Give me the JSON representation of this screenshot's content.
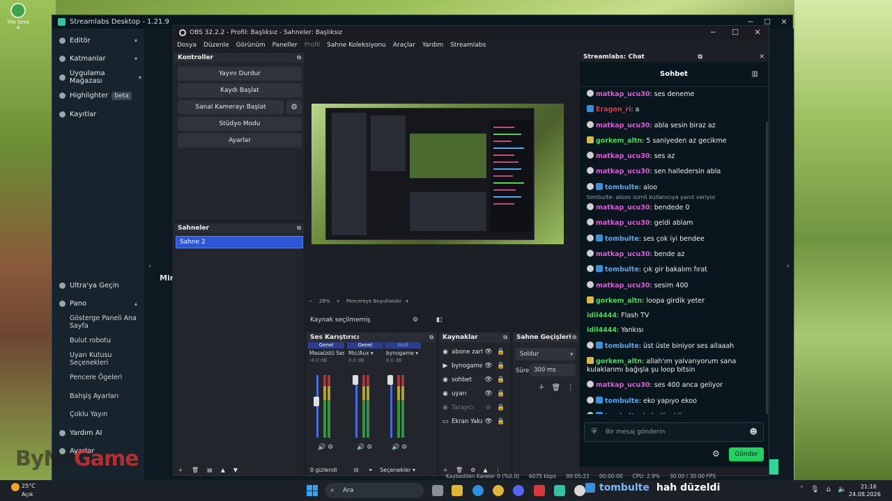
{
  "desktop": {
    "icon_label": "The Sims 4"
  },
  "streamlabs": {
    "title": "Streamlabs Desktop - 1.21.9",
    "nav_top": [
      {
        "label": "Editör"
      },
      {
        "label": "Katmanlar"
      },
      {
        "label": "Uygulama Mağazası"
      },
      {
        "label": "Highlighter",
        "badge": "beta"
      },
      {
        "label": "Kayıtlar"
      }
    ],
    "nav_bottom": {
      "ultra": "Ultra'ya Geçin",
      "pano": "Pano",
      "pano_items": [
        "Gösterge Paneli Ana Sayfa",
        "Bulut robotu",
        "Uyarı Kutusu Seçenekleri",
        "Pencere Ögeleri",
        "Bahşiş Ayarları",
        "Çoklu Yayın"
      ],
      "yardim": "Yardım AI",
      "ayarlar": "Ayarlar"
    },
    "mini_label": "Min"
  },
  "obs": {
    "title": "OBS 32.2.2 - Profil: Başlıksız - Sahneler: Başlıksız",
    "menu": [
      "Dosya",
      "Düzenle",
      "Görünüm",
      "Paneller",
      "Profil",
      "Sahne Koleksiyonu",
      "Araçlar",
      "Yardım",
      "Streamlabs"
    ],
    "controls": {
      "title": "Kontroller",
      "buttons": [
        "Yayını Durdur",
        "Kaydı Başlat",
        "Sanal Kamerayı Başlat",
        "Stüdyo Modu",
        "Ayarlar"
      ]
    },
    "scenes": {
      "title": "Sahneler",
      "items": [
        "Sahne 2"
      ]
    },
    "preview_zoom": "28%",
    "preview_fit": "Pencereye Boyutlandır",
    "no_source": "Kaynak seçilmemiş",
    "mixer": {
      "title": "Ses Karıştırıcı",
      "channels": [
        {
          "tag": "Genel",
          "name": "Masaüstü Ses",
          "db": "-4.0 dB",
          "level": 0.35
        },
        {
          "tag": "Genel",
          "name": "Mic/Aux",
          "db": "0.0 dB",
          "level": 0.0
        },
        {
          "tag": "Aktif",
          "name": "bynogame",
          "db": "0.0 dB",
          "level": 0.0
        }
      ],
      "hidden": "0 gizlendi",
      "options": "Seçenekler"
    },
    "sources": {
      "title": "Kaynaklar",
      "items": [
        {
          "icon": "globe-icon",
          "name": "abone zart",
          "dim": false
        },
        {
          "icon": "play-icon",
          "name": "bynogame",
          "dim": false
        },
        {
          "icon": "globe-icon",
          "name": "sohbet",
          "dim": false
        },
        {
          "icon": "globe-icon",
          "name": "uyarı",
          "dim": false
        },
        {
          "icon": "globe-icon",
          "name": "Tarayıcı",
          "dim": true
        },
        {
          "icon": "monitor-icon",
          "name": "Ekran Yaka",
          "dim": false
        }
      ]
    },
    "transitions": {
      "title": "Sahne Geçişleri",
      "type": "Soldur",
      "duration_label": "Süre",
      "duration": "300 ms"
    },
    "status": [
      "Kaybedilen Kareler 0 (%0.0)",
      "6075 kbps",
      "00:05:21",
      "00:00:00",
      "CPU: 2.9%",
      "30.00 / 30.00 FPS"
    ]
  },
  "chat": {
    "header": "Streamlabs: Chat",
    "title": "Sohbet",
    "messages": [
      {
        "user": "matkap_ucu30",
        "text": "ses deneme",
        "color": "#e05ad8",
        "badge": "circle"
      },
      {
        "user": "Eragon_ri",
        "text": "a",
        "color": "#e0384b",
        "badge": "square"
      },
      {
        "user": "matkap_ucu30",
        "text": "abla sesin biraz az",
        "color": "#e05ad8",
        "badge": "circle"
      },
      {
        "user": "gorkem_altn",
        "text": "5 saniyeden az gecikme",
        "color": "#4ed85a",
        "badge": "sub"
      },
      {
        "user": "matkap_ucu30",
        "text": "ses az",
        "color": "#e05ad8",
        "badge": "circle"
      },
      {
        "user": "matkap_ucu30",
        "text": "sen halledersin abla",
        "color": "#e05ad8",
        "badge": "circle"
      },
      {
        "user": "tombulte",
        "text": "aloo",
        "color": "#5aa8f0",
        "badge": "both"
      },
      {
        "user": "matkap_ucu30",
        "text": "bendede 0",
        "color": "#e05ad8",
        "badge": "circle",
        "reply": "tombulte: alooo isimli kullanıcıya yanıt veriyor"
      },
      {
        "user": "matkap_ucu30",
        "text": "geldi ablam",
        "color": "#e05ad8",
        "badge": "circle"
      },
      {
        "user": "tombulte",
        "text": "ses çok iyi bendee",
        "color": "#5aa8f0",
        "badge": "both"
      },
      {
        "user": "matkap_ucu30",
        "text": "bende az",
        "color": "#e05ad8",
        "badge": "circle"
      },
      {
        "user": "tombulte",
        "text": "çık gir bakalım fırat",
        "color": "#5aa8f0",
        "badge": "both"
      },
      {
        "user": "matkap_ucu30",
        "text": "sesim 400",
        "color": "#e05ad8",
        "badge": "circle"
      },
      {
        "user": "gorkem_altn",
        "text": "loopa girdik yeter",
        "color": "#4ed85a",
        "badge": "sub"
      },
      {
        "user": "idil4444",
        "text": "Flash TV",
        "color": "#4ed85a",
        "badge": "none"
      },
      {
        "user": "idil4444",
        "text": "Yankısı",
        "color": "#4ed85a",
        "badge": "none"
      },
      {
        "user": "tombulte",
        "text": "üst üste biniyor ses allaaah",
        "color": "#5aa8f0",
        "badge": "both"
      },
      {
        "user": "gorkem_altn",
        "text": "allah'ım yalvarıyorum sana kulaklarımı bağışla şu loop bitsin",
        "color": "#4ed85a",
        "badge": "sub"
      },
      {
        "user": "matkap_ucu30",
        "text": "ses 400 anca geliyor",
        "color": "#e05ad8",
        "badge": "circle"
      },
      {
        "user": "tombulte",
        "text": "eko yapıyo ekoo",
        "color": "#5aa8f0",
        "badge": "both"
      },
      {
        "user": "tombulte",
        "text": "hah düzeldi",
        "color": "#5aa8f0",
        "badge": "both"
      }
    ],
    "input_placeholder": "Bir mesaj gönderin",
    "send_label": "Gönder"
  },
  "taskbar": {
    "weather_temp": "25°C",
    "weather_desc": "Açık",
    "search_placeholder": "Ara",
    "overlay_user": "tombulte",
    "overlay_text": "hah düzeldi",
    "time": "21:16",
    "date": "24.08.2026"
  },
  "watermark": {
    "text_a": "ByNo",
    "text_b": "Game"
  }
}
